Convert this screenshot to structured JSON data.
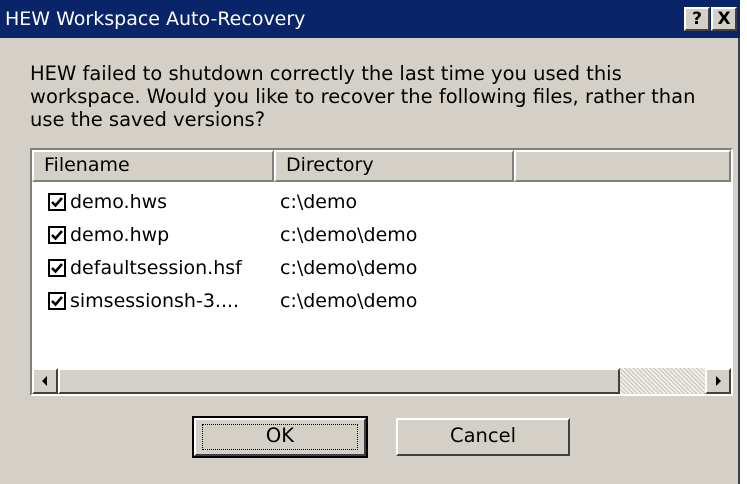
{
  "window": {
    "title": "HEW Workspace Auto-Recovery",
    "help_label": "?",
    "close_label": "X"
  },
  "message": "HEW failed to shutdown correctly the last time you used this workspace. Would you like to recover the following files, rather than use the saved versions?",
  "list": {
    "columns": [
      "Filename",
      "Directory",
      ""
    ],
    "rows": [
      {
        "checked": true,
        "filename": "demo.hws",
        "directory": "c:\\demo"
      },
      {
        "checked": true,
        "filename": "demo.hwp",
        "directory": "c:\\demo\\demo"
      },
      {
        "checked": true,
        "filename": "defaultsession.hsf",
        "directory": "c:\\demo\\demo"
      },
      {
        "checked": true,
        "filename": "simsessionsh-3....",
        "directory": "c:\\demo\\demo"
      }
    ]
  },
  "buttons": {
    "ok": "OK",
    "cancel": "Cancel"
  },
  "icons": {
    "checkbox": "checkmark-icon",
    "scroll_left": "arrow-left-icon",
    "scroll_right": "arrow-right-icon"
  },
  "colors": {
    "titlebar": "#0a246a",
    "face": "#d4d0c8"
  }
}
